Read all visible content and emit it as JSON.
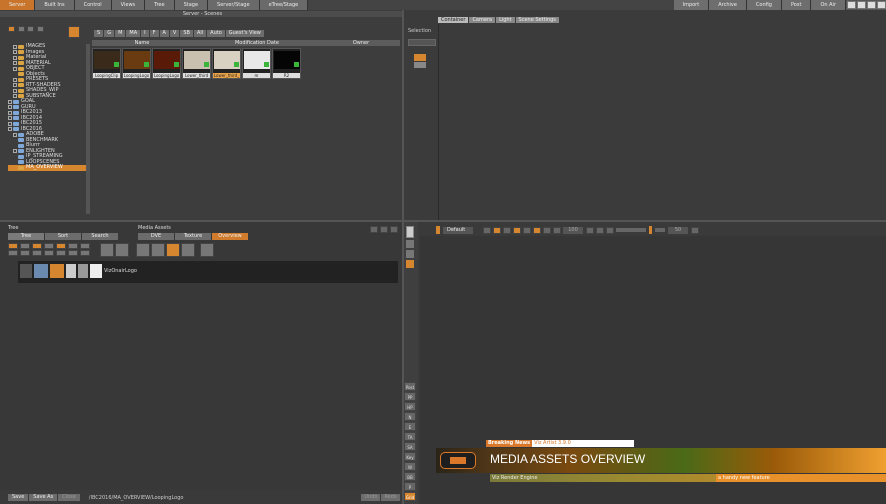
{
  "menu": {
    "left": [
      "Server",
      "Built Ins",
      "Control",
      "Views",
      "Tree",
      "Stage",
      "Server/Stage",
      "eTree/Stage"
    ],
    "right": [
      "Import",
      "Archive",
      "Config",
      "Post",
      "On Air"
    ]
  },
  "server": {
    "header": "Server - Scenes",
    "filters": [
      "S",
      "G",
      "M",
      "MA",
      "I",
      "F",
      "A",
      "V",
      "SB",
      "All",
      "Auto",
      "Guest's View"
    ],
    "columns": [
      "Name",
      "Modification Date",
      "Owner"
    ],
    "folders": [
      {
        "label": "IMAGES",
        "level": 1,
        "color": "yellow",
        "expand": true
      },
      {
        "label": "Images",
        "level": 1,
        "color": "yellow",
        "expand": true
      },
      {
        "label": "Material",
        "level": 1,
        "color": "yellow",
        "expand": true
      },
      {
        "label": "MATERIAL",
        "level": 1,
        "color": "yellow",
        "expand": true
      },
      {
        "label": "OBJECT",
        "level": 1,
        "color": "yellow",
        "expand": true
      },
      {
        "label": "Objects",
        "level": 1,
        "color": "yellow",
        "expand": false
      },
      {
        "label": "PRESETS",
        "level": 1,
        "color": "yellow",
        "expand": true
      },
      {
        "label": "RTT-SHADERS",
        "level": 1,
        "color": "yellow",
        "expand": true
      },
      {
        "label": "SHADES_WIP",
        "level": 1,
        "color": "yellow",
        "expand": true
      },
      {
        "label": "SUBSTANCE",
        "level": 1,
        "color": "yellow",
        "expand": true
      },
      {
        "label": "GOAL",
        "level": 0,
        "color": "blue",
        "expand": true
      },
      {
        "label": "GURU",
        "level": 0,
        "color": "blue",
        "expand": true
      },
      {
        "label": "IBC2013",
        "level": 0,
        "color": "blue",
        "expand": true
      },
      {
        "label": "IBC2014",
        "level": 0,
        "color": "blue",
        "expand": true
      },
      {
        "label": "IBC2015",
        "level": 0,
        "color": "blue",
        "expand": true
      },
      {
        "label": "IBC2016",
        "level": 0,
        "color": "blue",
        "expand": true
      },
      {
        "label": "ADOBE",
        "level": 1,
        "color": "blue",
        "expand": true
      },
      {
        "label": "BENCHMARK",
        "level": 1,
        "color": "blue",
        "expand": false
      },
      {
        "label": "Blurrr",
        "level": 1,
        "color": "blue",
        "expand": false
      },
      {
        "label": "ENLIGHTEN",
        "level": 1,
        "color": "blue",
        "expand": true
      },
      {
        "label": "IP_STREAMING",
        "level": 1,
        "color": "blue",
        "expand": false
      },
      {
        "label": "LOOPSCENES",
        "level": 1,
        "color": "blue",
        "expand": false
      },
      {
        "label": "MA_OVERVIEW",
        "level": 1,
        "color": "yellow",
        "expand": false,
        "selected": true
      }
    ],
    "thumbnails": [
      {
        "label": "LoopingClip",
        "color": "#3a2a1a"
      },
      {
        "label": "LoopingLogo",
        "color": "#6a3a10"
      },
      {
        "label": "LoopingLogo",
        "color": "#5a1a08"
      },
      {
        "label": "Lower_third",
        "color": "#c9c0b0"
      },
      {
        "label": "Lower_third_",
        "color": "#d8d0c0",
        "selected": true
      },
      {
        "label": "m",
        "color": "#e8e8e8"
      },
      {
        "label": "R2",
        "color": "#050505"
      }
    ]
  },
  "right_tabs": [
    "Container",
    "Camera",
    "Light",
    "Scene Settings"
  ],
  "selection_label": "Selection",
  "tree": {
    "header": "Tree",
    "tabs": [
      "Tree",
      "Sort",
      "Search"
    ],
    "node_label": "VizOnairLogo"
  },
  "media_assets": {
    "header": "Media Assets",
    "tabs": [
      "DVE",
      "Texture",
      "Overview"
    ]
  },
  "director": {
    "name": "Default",
    "frame": "100",
    "frame2": "50"
  },
  "side_buttons": [
    "Post",
    "PP",
    "HP",
    "N",
    "E",
    "TA",
    "SA",
    "Key",
    "W",
    "BB",
    "P",
    "Grid"
  ],
  "render": {
    "breaking": "Breaking News",
    "artist": "Viz Artist 3.9.0",
    "title": "MEDIA ASSETS OVERVIEW",
    "engine": "Viz Render Engine",
    "feature": "a handy new feature"
  },
  "bottom": {
    "buttons": [
      "Save",
      "Save As",
      "Close"
    ],
    "path": "/IBC2016/MA_OVERVIEW/LoopingLogo",
    "right_buttons": [
      "Undo",
      "Redo"
    ]
  }
}
